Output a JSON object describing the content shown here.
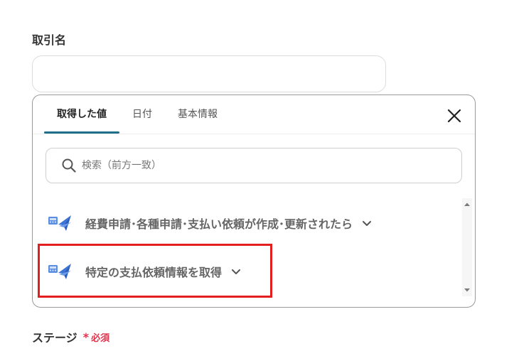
{
  "deal_name_field": {
    "label": "取引名",
    "value": ""
  },
  "popup": {
    "tabs": [
      {
        "label": "取得した値",
        "active": true
      },
      {
        "label": "日付",
        "active": false
      },
      {
        "label": "基本情報",
        "active": false
      }
    ],
    "close_icon": "close-icon",
    "search": {
      "placeholder": "検索（前方一致）",
      "icon": "search-icon"
    },
    "items": [
      {
        "label": "経費申請･各種申請･支払い依頼が作成･更新されたら",
        "icon": "app-icon",
        "expand_icon": "chevron-down-icon"
      },
      {
        "label": "特定の支払依頼情報を取得",
        "icon": "app-icon",
        "expand_icon": "chevron-down-icon"
      }
    ]
  },
  "stage_field": {
    "label": "ステージ",
    "required_mark": "*",
    "required_text": "必須"
  },
  "colors": {
    "accent": "#1f6e8a",
    "highlight": "#e21e1e",
    "required": "#e0334d"
  }
}
